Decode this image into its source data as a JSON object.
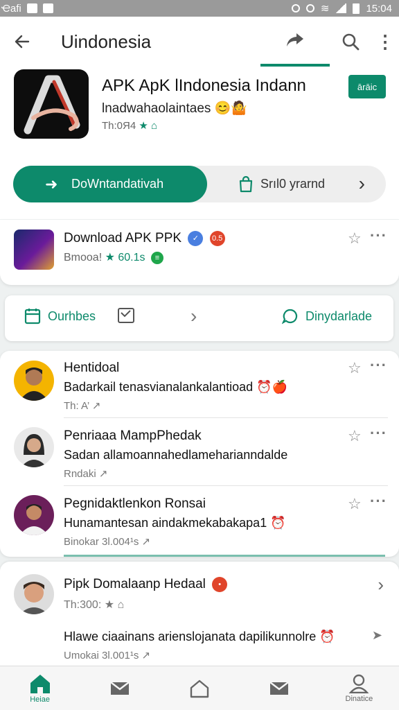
{
  "status_bar": {
    "carrier": "Ҽafi",
    "time": "15:04"
  },
  "app_bar": {
    "title": "Uindonesia"
  },
  "hero": {
    "title": "APK ApK lIndonesia Indann",
    "subtitle": "lnadwahaolaintaes 😊🤷",
    "meta_prefix": "Th:0Я4",
    "meta_icons": "★ ⌂",
    "badge": "ārāic",
    "download_label": "DoWntandativah",
    "secondary_label": "Srıl0 yrarnd"
  },
  "app_row": {
    "title": "Download APK PPK",
    "meta": "Bmooa!",
    "rating": "★ 60.1s",
    "badge_right": "0.5"
  },
  "toolbar": {
    "left_label": "Ourhbes",
    "right_label": "Dinydarlade"
  },
  "feed": [
    {
      "title": "Hentidoal",
      "text": "Badarkail tenasvianalankalantioad ⏰🍎",
      "meta": "Th: A’ ↗"
    },
    {
      "title": "Penriaaa MampPhedak",
      "text": "Sadan allamoannahedlameharianndalde",
      "meta": "Rndaki ↗"
    },
    {
      "title": "Pegnidaktlenkon Ronsai",
      "text": "Hunamantesan aindakmekabakapa1 ⏰",
      "meta": "Binokar 3l.004¹s ↗"
    }
  ],
  "feed2": {
    "title": "Pipk Domalaanp Hedaal",
    "meta": "Th:300:",
    "text": "Hlawe ciaainans arienslojanata dapilikunnolre ⏰",
    "meta2": "Umokai 3l.001¹s ↗"
  },
  "bottom_nav": [
    {
      "label": "Heiae",
      "icon": "home-icon"
    },
    {
      "label": "",
      "icon": "mail-icon"
    },
    {
      "label": "",
      "icon": "house-outline-icon"
    },
    {
      "label": "",
      "icon": "mail-icon"
    },
    {
      "label": "Dinatice",
      "icon": "profile-icon"
    }
  ],
  "colors": {
    "accent": "#0d8a6b"
  }
}
